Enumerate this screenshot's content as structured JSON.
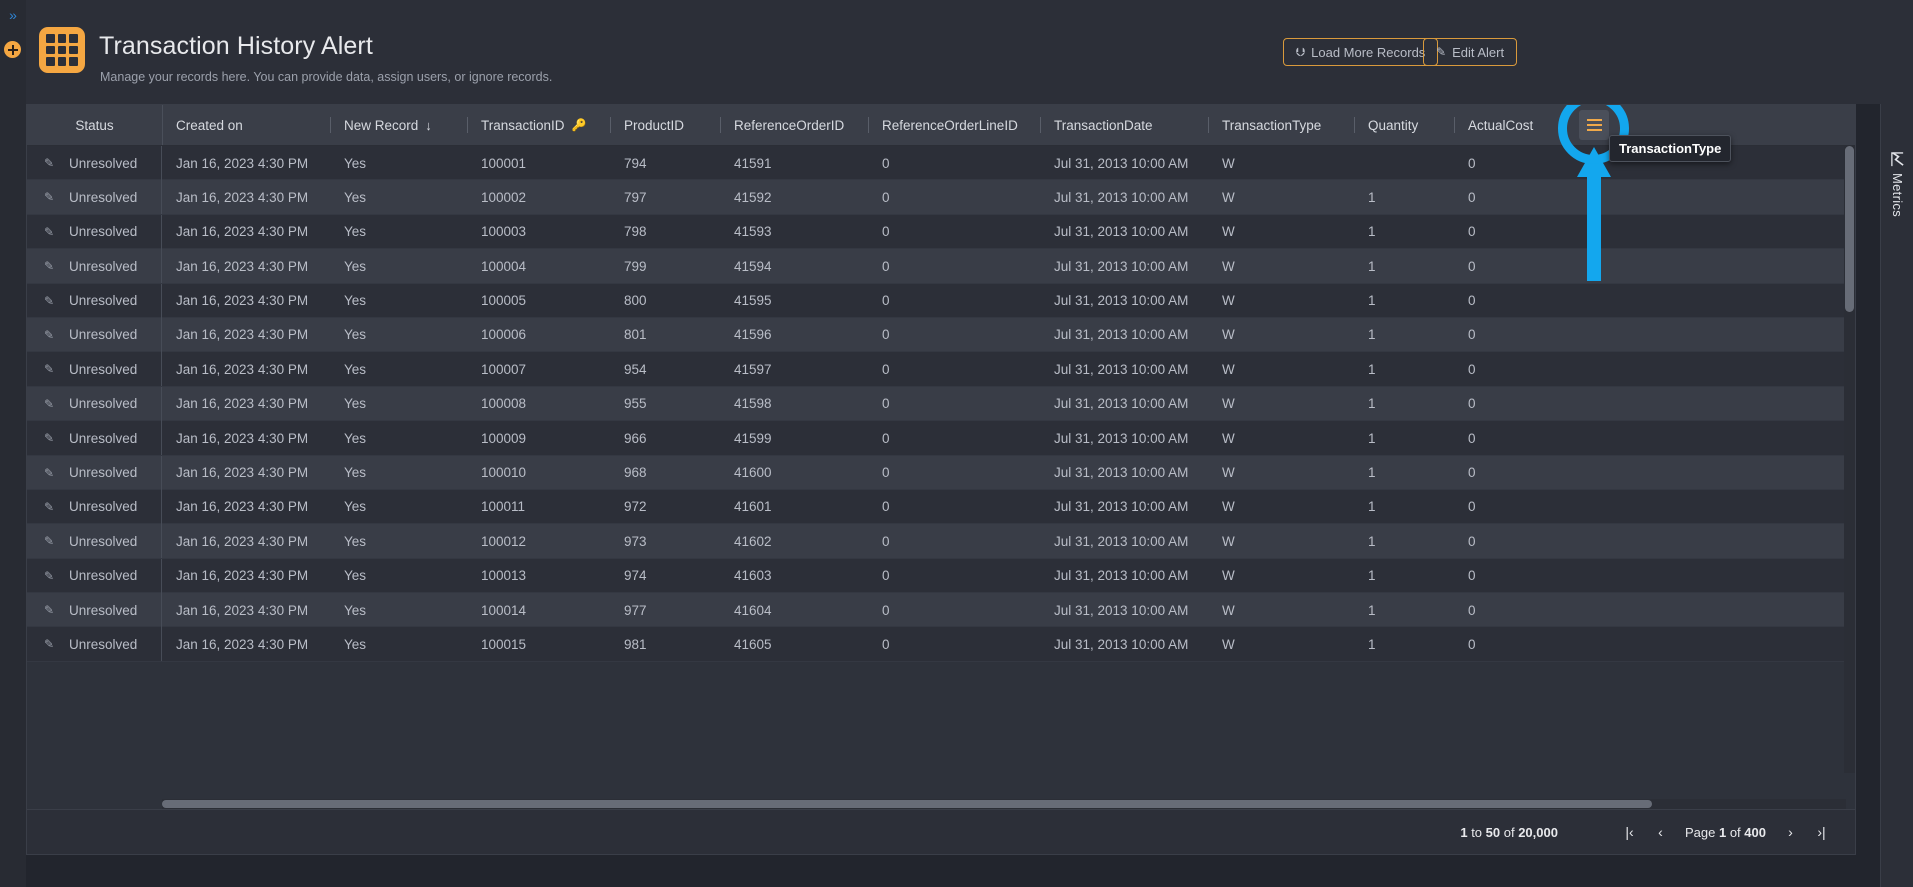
{
  "left_rail": {
    "expand_icon": "chevron-double-right-icon",
    "expand_glyph": "»",
    "add_icon": "plus-circle-icon"
  },
  "header": {
    "icon": "grid-table-icon",
    "title": "Transaction History Alert",
    "subtitle": "Manage your records here. You can provide data, assign users, or ignore records.",
    "buttons": [
      {
        "label": "Load More Records",
        "icon": "download-circle-icon",
        "glyph": "⮋"
      },
      {
        "label": "Edit Alert",
        "icon": "pencil-square-icon",
        "glyph": "✎"
      }
    ],
    "accent_color": "#f5a742",
    "button_border_color": "#d99a3c"
  },
  "grid": {
    "columns": [
      {
        "label": "Status",
        "name": "status"
      },
      {
        "label": "Created on",
        "name": "created-on"
      },
      {
        "label": "New Record",
        "name": "new-record",
        "sort": "desc",
        "sort_glyph": "↓"
      },
      {
        "label": "TransactionID",
        "name": "transaction-id",
        "key": true,
        "key_glyph": "🔑"
      },
      {
        "label": "ProductID",
        "name": "product-id"
      },
      {
        "label": "ReferenceOrderID",
        "name": "reference-order-id"
      },
      {
        "label": "ReferenceOrderLineID",
        "name": "reference-order-line-id"
      },
      {
        "label": "TransactionDate",
        "name": "transaction-date"
      },
      {
        "label": "TransactionType",
        "name": "transaction-type"
      },
      {
        "label": "Quantity",
        "name": "quantity"
      },
      {
        "label": "ActualCost",
        "name": "actual-cost"
      }
    ],
    "column_menu": {
      "icon": "hamburger-menu-icon",
      "tooltip": "TransactionType"
    },
    "highlight_color": "#13a7ee",
    "row_edit_icon": "pencil-icon",
    "rows": [
      {
        "status": "Unresolved",
        "created_on": "Jan 16, 2023 4:30 PM",
        "new_record": "Yes",
        "transaction_id": "100001",
        "product_id": "794",
        "reference_order_id": "41591",
        "reference_order_line_id": "0",
        "transaction_date": "Jul 31, 2013 10:00 AM",
        "transaction_type": "W",
        "quantity": "",
        "actual_cost": "0"
      },
      {
        "status": "Unresolved",
        "created_on": "Jan 16, 2023 4:30 PM",
        "new_record": "Yes",
        "transaction_id": "100002",
        "product_id": "797",
        "reference_order_id": "41592",
        "reference_order_line_id": "0",
        "transaction_date": "Jul 31, 2013 10:00 AM",
        "transaction_type": "W",
        "quantity": "1",
        "actual_cost": "0"
      },
      {
        "status": "Unresolved",
        "created_on": "Jan 16, 2023 4:30 PM",
        "new_record": "Yes",
        "transaction_id": "100003",
        "product_id": "798",
        "reference_order_id": "41593",
        "reference_order_line_id": "0",
        "transaction_date": "Jul 31, 2013 10:00 AM",
        "transaction_type": "W",
        "quantity": "1",
        "actual_cost": "0"
      },
      {
        "status": "Unresolved",
        "created_on": "Jan 16, 2023 4:30 PM",
        "new_record": "Yes",
        "transaction_id": "100004",
        "product_id": "799",
        "reference_order_id": "41594",
        "reference_order_line_id": "0",
        "transaction_date": "Jul 31, 2013 10:00 AM",
        "transaction_type": "W",
        "quantity": "1",
        "actual_cost": "0"
      },
      {
        "status": "Unresolved",
        "created_on": "Jan 16, 2023 4:30 PM",
        "new_record": "Yes",
        "transaction_id": "100005",
        "product_id": "800",
        "reference_order_id": "41595",
        "reference_order_line_id": "0",
        "transaction_date": "Jul 31, 2013 10:00 AM",
        "transaction_type": "W",
        "quantity": "1",
        "actual_cost": "0"
      },
      {
        "status": "Unresolved",
        "created_on": "Jan 16, 2023 4:30 PM",
        "new_record": "Yes",
        "transaction_id": "100006",
        "product_id": "801",
        "reference_order_id": "41596",
        "reference_order_line_id": "0",
        "transaction_date": "Jul 31, 2013 10:00 AM",
        "transaction_type": "W",
        "quantity": "1",
        "actual_cost": "0"
      },
      {
        "status": "Unresolved",
        "created_on": "Jan 16, 2023 4:30 PM",
        "new_record": "Yes",
        "transaction_id": "100007",
        "product_id": "954",
        "reference_order_id": "41597",
        "reference_order_line_id": "0",
        "transaction_date": "Jul 31, 2013 10:00 AM",
        "transaction_type": "W",
        "quantity": "1",
        "actual_cost": "0"
      },
      {
        "status": "Unresolved",
        "created_on": "Jan 16, 2023 4:30 PM",
        "new_record": "Yes",
        "transaction_id": "100008",
        "product_id": "955",
        "reference_order_id": "41598",
        "reference_order_line_id": "0",
        "transaction_date": "Jul 31, 2013 10:00 AM",
        "transaction_type": "W",
        "quantity": "1",
        "actual_cost": "0"
      },
      {
        "status": "Unresolved",
        "created_on": "Jan 16, 2023 4:30 PM",
        "new_record": "Yes",
        "transaction_id": "100009",
        "product_id": "966",
        "reference_order_id": "41599",
        "reference_order_line_id": "0",
        "transaction_date": "Jul 31, 2013 10:00 AM",
        "transaction_type": "W",
        "quantity": "1",
        "actual_cost": "0"
      },
      {
        "status": "Unresolved",
        "created_on": "Jan 16, 2023 4:30 PM",
        "new_record": "Yes",
        "transaction_id": "100010",
        "product_id": "968",
        "reference_order_id": "41600",
        "reference_order_line_id": "0",
        "transaction_date": "Jul 31, 2013 10:00 AM",
        "transaction_type": "W",
        "quantity": "1",
        "actual_cost": "0"
      },
      {
        "status": "Unresolved",
        "created_on": "Jan 16, 2023 4:30 PM",
        "new_record": "Yes",
        "transaction_id": "100011",
        "product_id": "972",
        "reference_order_id": "41601",
        "reference_order_line_id": "0",
        "transaction_date": "Jul 31, 2013 10:00 AM",
        "transaction_type": "W",
        "quantity": "1",
        "actual_cost": "0"
      },
      {
        "status": "Unresolved",
        "created_on": "Jan 16, 2023 4:30 PM",
        "new_record": "Yes",
        "transaction_id": "100012",
        "product_id": "973",
        "reference_order_id": "41602",
        "reference_order_line_id": "0",
        "transaction_date": "Jul 31, 2013 10:00 AM",
        "transaction_type": "W",
        "quantity": "1",
        "actual_cost": "0"
      },
      {
        "status": "Unresolved",
        "created_on": "Jan 16, 2023 4:30 PM",
        "new_record": "Yes",
        "transaction_id": "100013",
        "product_id": "974",
        "reference_order_id": "41603",
        "reference_order_line_id": "0",
        "transaction_date": "Jul 31, 2013 10:00 AM",
        "transaction_type": "W",
        "quantity": "1",
        "actual_cost": "0"
      },
      {
        "status": "Unresolved",
        "created_on": "Jan 16, 2023 4:30 PM",
        "new_record": "Yes",
        "transaction_id": "100014",
        "product_id": "977",
        "reference_order_id": "41604",
        "reference_order_line_id": "0",
        "transaction_date": "Jul 31, 2013 10:00 AM",
        "transaction_type": "W",
        "quantity": "1",
        "actual_cost": "0"
      },
      {
        "status": "Unresolved",
        "created_on": "Jan 16, 2023 4:30 PM",
        "new_record": "Yes",
        "transaction_id": "100015",
        "product_id": "981",
        "reference_order_id": "41605",
        "reference_order_line_id": "0",
        "transaction_date": "Jul 31, 2013 10:00 AM",
        "transaction_type": "W",
        "quantity": "1",
        "actual_cost": "0"
      }
    ]
  },
  "pager": {
    "range_prefix": "1",
    "range_mid": " to ",
    "range_to": "50",
    "range_of": " of ",
    "range_total": "20,000",
    "first_glyph": "|‹",
    "prev_glyph": "‹",
    "page_word": "Page",
    "page_current": "1",
    "page_of": "of",
    "page_total": "400",
    "next_glyph": "›",
    "last_glyph": "›|"
  },
  "metrics_tab": {
    "label": "Metrics",
    "icon": "chart-line-icon"
  }
}
